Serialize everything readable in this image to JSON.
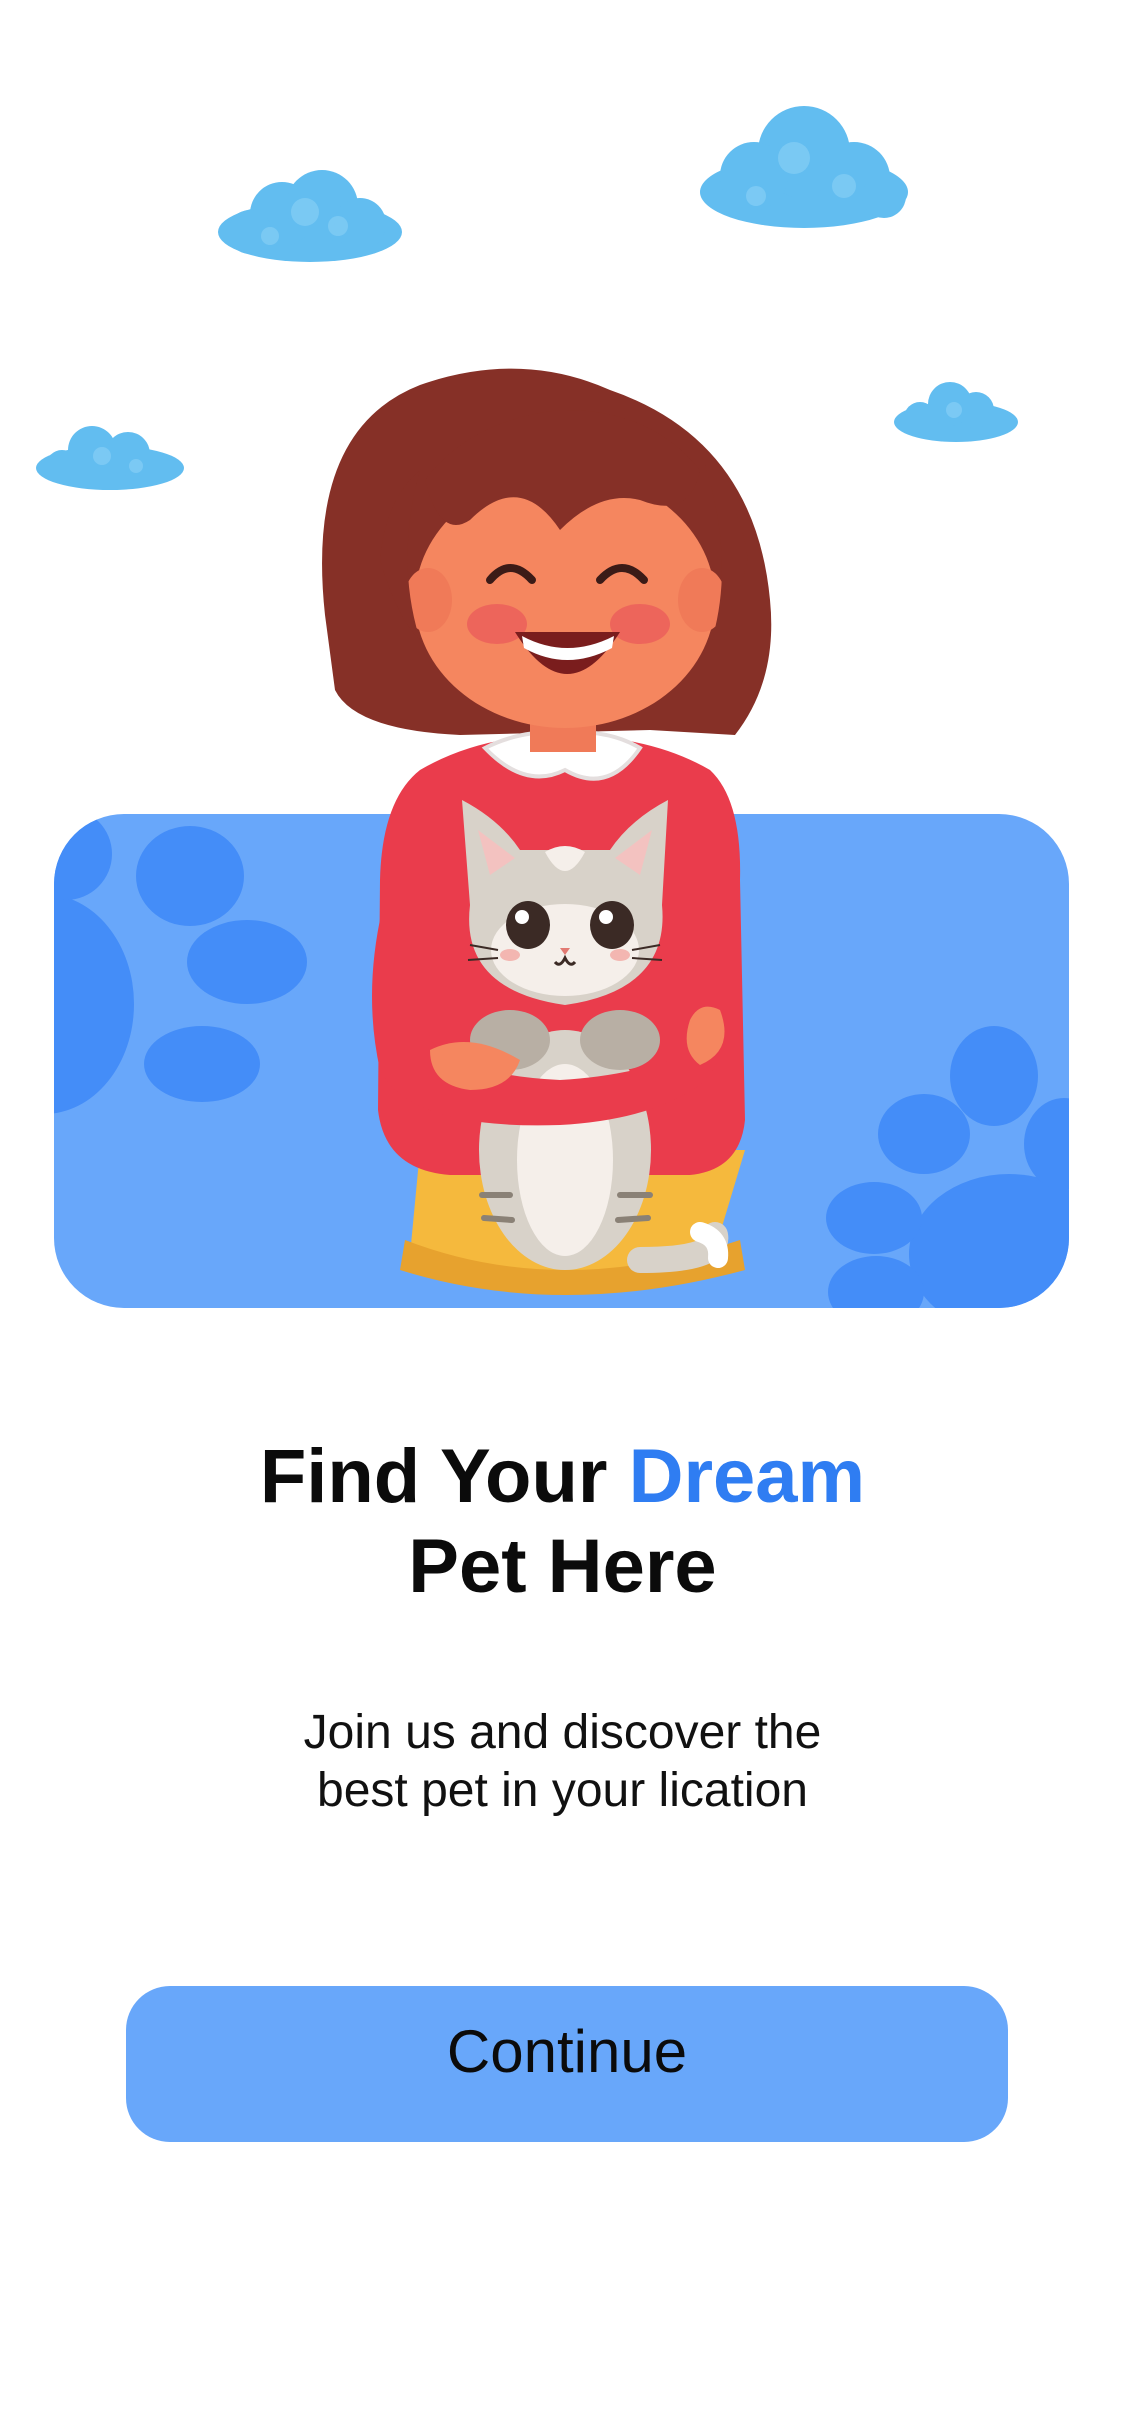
{
  "onboarding": {
    "title_part1": "Find Your ",
    "title_accent": "Dream",
    "title_line2": "Pet Here",
    "subtitle_line1": "Join us and discover the",
    "subtitle_line2": "best pet in your lication",
    "continue_label": "Continue"
  },
  "colors": {
    "accent": "#2f7df2",
    "card_background": "#68a7fa",
    "button_background": "#68a7fa",
    "paw_print": "#448df8",
    "cloud": "#5fbdf0"
  },
  "illustration": {
    "subject": "girl-holding-cat-icon",
    "decorations": [
      "cloud-icon",
      "paw-print-icon"
    ]
  }
}
